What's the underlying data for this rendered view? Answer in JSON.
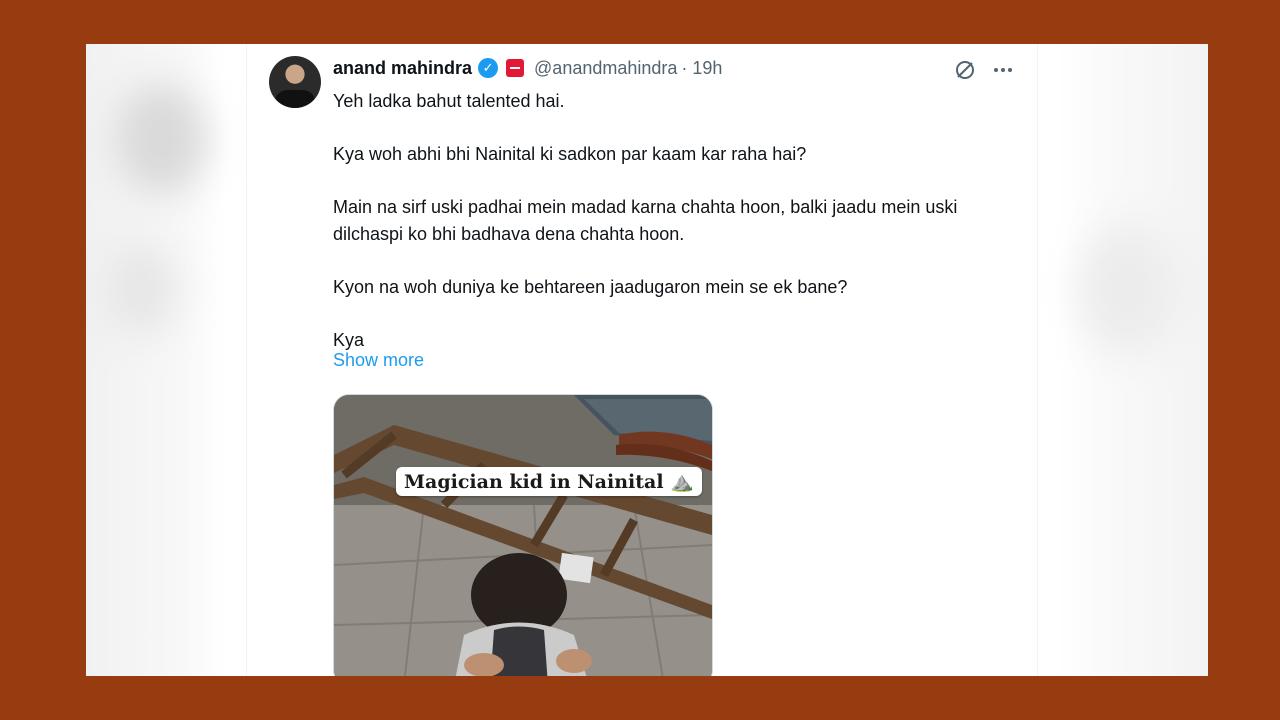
{
  "tweet": {
    "author": {
      "name": "anand mahindra",
      "handle": "@anandmahindra",
      "time": "· 19h",
      "verified_icon": "verified-check-icon",
      "affiliate_icon": "affiliate-badge-icon"
    },
    "actions": {
      "grok_icon": "grok-icon",
      "more_icon": "more-options-icon"
    },
    "paragraphs": [
      "Yeh ladka bahut talented hai.",
      "Kya woh abhi bhi Nainital ki sadkon par kaam kar raha hai?",
      "Main na sirf uski padhai mein madad karna chahta hoon, balki jaadu mein uski dilchaspi ko bhi badhava dena chahta hoon.",
      "Kyon na woh duniya ke behtareen jaadugaron mein se ek bane?",
      "Kya"
    ],
    "show_more": "Show more",
    "media": {
      "caption": "Magician kid in Nainital ⛰️"
    }
  },
  "colors": {
    "frame": "#963c10",
    "link": "#1d9bf0",
    "verified": "#1d9bf0",
    "text": "#0f1419",
    "muted": "#536471"
  }
}
